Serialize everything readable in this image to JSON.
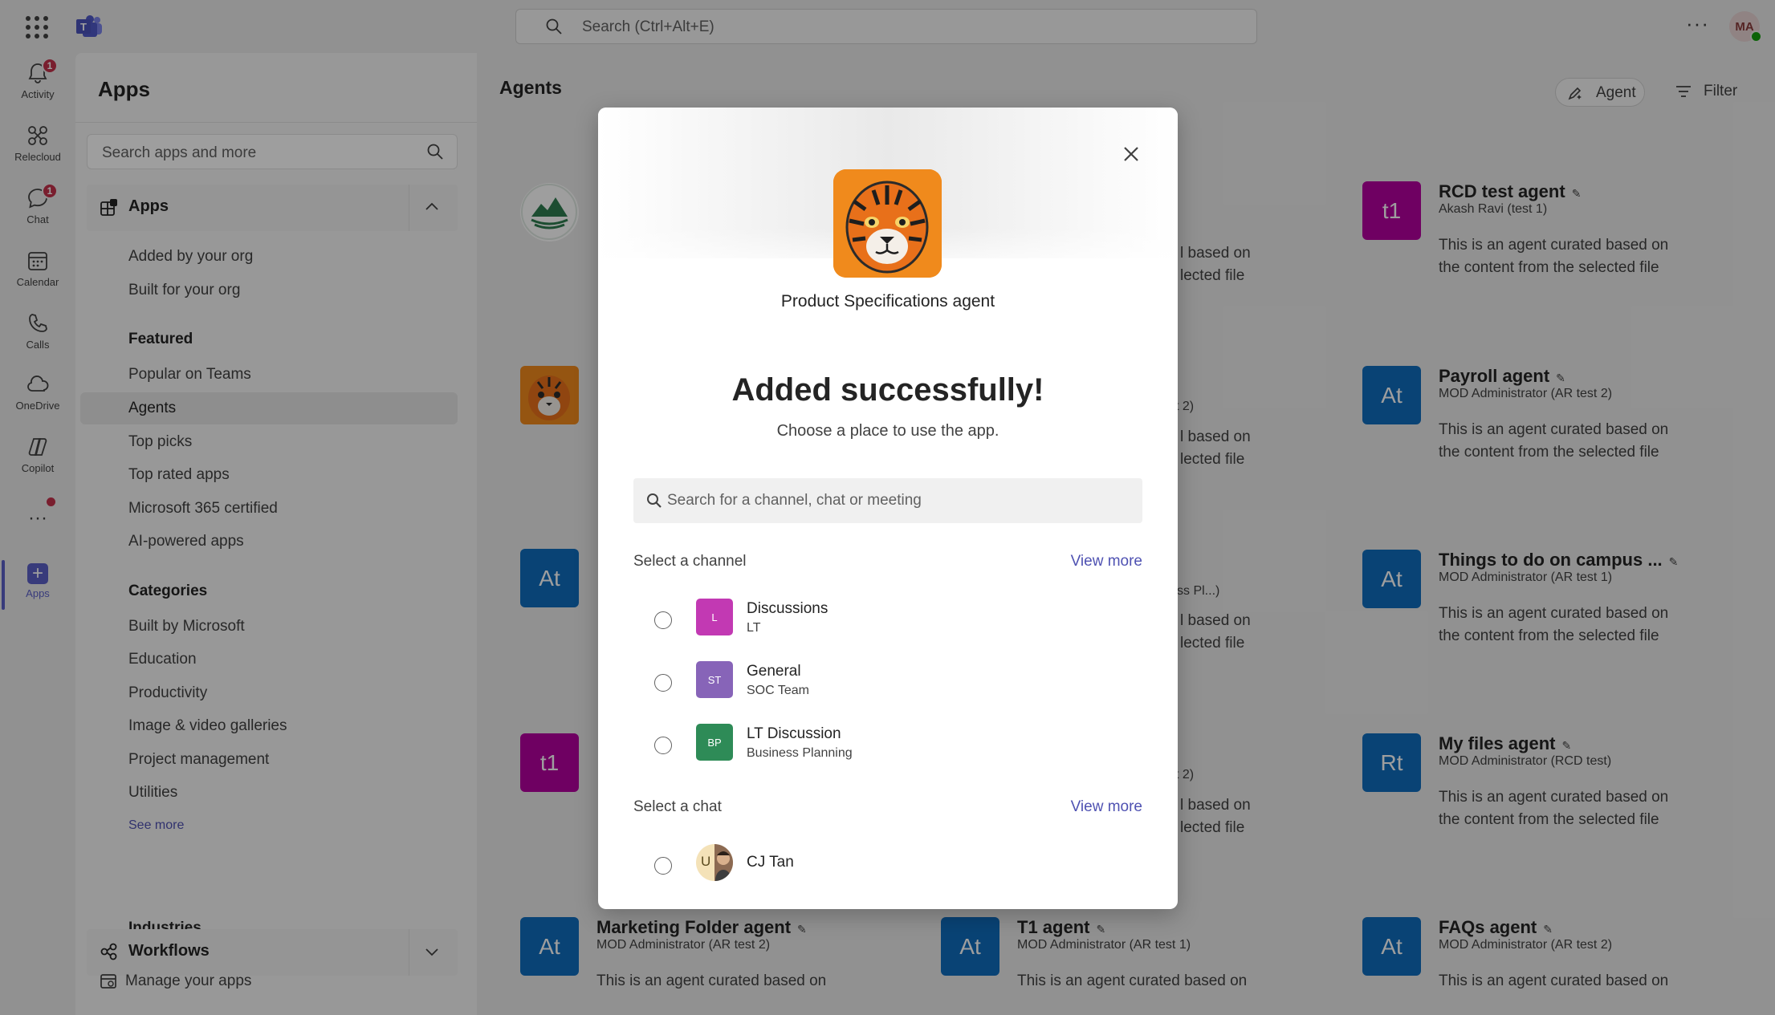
{
  "topbar": {
    "search_placeholder": "Search (Ctrl+Alt+E)",
    "more_label": "···",
    "avatar_initials": "MA"
  },
  "rail": {
    "items": [
      {
        "label": "Activity",
        "badge": "1"
      },
      {
        "label": "Relecloud"
      },
      {
        "label": "Chat",
        "badge": "1"
      },
      {
        "label": "Calendar"
      },
      {
        "label": "Calls"
      },
      {
        "label": "OneDrive"
      },
      {
        "label": "Copilot"
      },
      {
        "label": "Apps"
      }
    ],
    "more_label": "···"
  },
  "apps_pane": {
    "title": "Apps",
    "search_placeholder": "Search apps and more",
    "apps_section": "Apps",
    "links_top": [
      "Added by your org",
      "Built for your org"
    ],
    "featured_title": "Featured",
    "featured": [
      "Popular on Teams",
      "Agents",
      "Top picks",
      "Top rated apps",
      "Microsoft 365 certified",
      "AI-powered apps"
    ],
    "categories_title": "Categories",
    "categories": [
      "Built by Microsoft",
      "Education",
      "Productivity",
      "Image & video galleries",
      "Project management",
      "Utilities"
    ],
    "see_more": "See more",
    "industries_title": "Industries",
    "workflows_section": "Workflows",
    "manage": "Manage your apps"
  },
  "agents": {
    "title": "Agents",
    "agent_button": "Agent",
    "filter_button": "Filter",
    "desc": "This is an agent curated based on the content from the selected file",
    "desc_short": "This is an agent curated based on",
    "right_column": [
      {
        "tile": "t1",
        "color": "#b4009e",
        "name": "RCD test agent",
        "sub": "Akash Ravi (test 1)"
      },
      {
        "tile": "At",
        "color": "#0f6cbd",
        "name": "Payroll agent",
        "sub": "MOD Administrator (AR test 2)"
      },
      {
        "tile": "At",
        "color": "#0f6cbd",
        "name": "Things to do on campus ...",
        "sub": "MOD Administrator (AR test 1)"
      },
      {
        "tile": "Rt",
        "color": "#0f6cbd",
        "name": "My files agent",
        "sub": "MOD Administrator (RCD test)"
      }
    ],
    "bottom_row": [
      {
        "tile": "At",
        "color": "#0f6cbd",
        "name": "Marketing Folder agent",
        "sub": "MOD Administrator (AR test 2)"
      },
      {
        "tile": "At",
        "color": "#0f6cbd",
        "name": "T1 agent",
        "sub": "MOD Administrator (AR test 1)"
      },
      {
        "tile": "At",
        "color": "#0f6cbd",
        "name": "FAQs agent",
        "sub": "MOD Administrator (AR test 2)"
      }
    ],
    "left_tiles": [
      {
        "tile": "At",
        "color": "#0f6cbd"
      },
      {
        "tile": "t1",
        "color": "#b4009e"
      }
    ],
    "partial_frag": {
      "based_on": "l based on",
      "selected_file": "lected file",
      "t2": "t 2)",
      "ss": "ss Pl...)"
    }
  },
  "dialog": {
    "app_name": "Product Specifications agent",
    "heading": "Added successfully!",
    "subheading": "Choose a place to use the app.",
    "search_placeholder": "Search for a channel, chat or meeting",
    "channel_label": "Select a channel",
    "chat_label": "Select a chat",
    "view_more": "View more",
    "channels": [
      {
        "tile": "L",
        "color": "#c239b3",
        "title": "Discussions",
        "sub": "LT"
      },
      {
        "tile": "ST",
        "color": "#8764b8",
        "title": "General",
        "sub": "SOC Team"
      },
      {
        "tile": "BP",
        "color": "#2e8b57",
        "title": "LT Discussion",
        "sub": "Business Planning"
      }
    ],
    "chats": [
      {
        "initial": "U",
        "title": "CJ Tan"
      }
    ]
  }
}
